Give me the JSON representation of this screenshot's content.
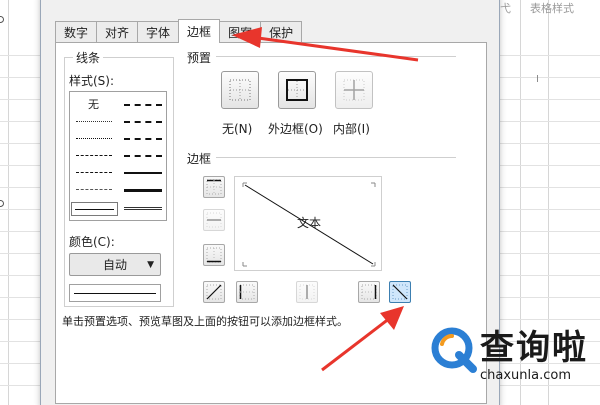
{
  "sheet": {
    "top_text_left": "弋",
    "top_text_right": "表格样式",
    "column_marker": "I"
  },
  "dialog": {
    "tabs": [
      {
        "label": "数字",
        "active": false
      },
      {
        "label": "对齐",
        "active": false
      },
      {
        "label": "字体",
        "active": false
      },
      {
        "label": "边框",
        "active": true
      },
      {
        "label": "图案",
        "active": false
      },
      {
        "label": "保护",
        "active": false
      }
    ],
    "line_group": {
      "title": "线条",
      "style_label": "样式(S):",
      "none_label": "无",
      "color_label": "颜色(C):",
      "color_value": "自动"
    },
    "presets": {
      "title": "预置",
      "none_label": "无(N)",
      "outline_label": "外边框(O)",
      "inside_label": "内部(I)"
    },
    "border": {
      "title": "边框",
      "preview_text": "文本"
    },
    "hint": "单击预置选项、预览草图及上面的按钮可以添加边框样式。"
  },
  "watermark": {
    "brand_cn": "查询啦",
    "brand_en": "chaxunla.com"
  },
  "colors": {
    "arrow": "#e8352c",
    "logo_blue": "#2b7fd4",
    "logo_orange": "#f39a1e"
  }
}
